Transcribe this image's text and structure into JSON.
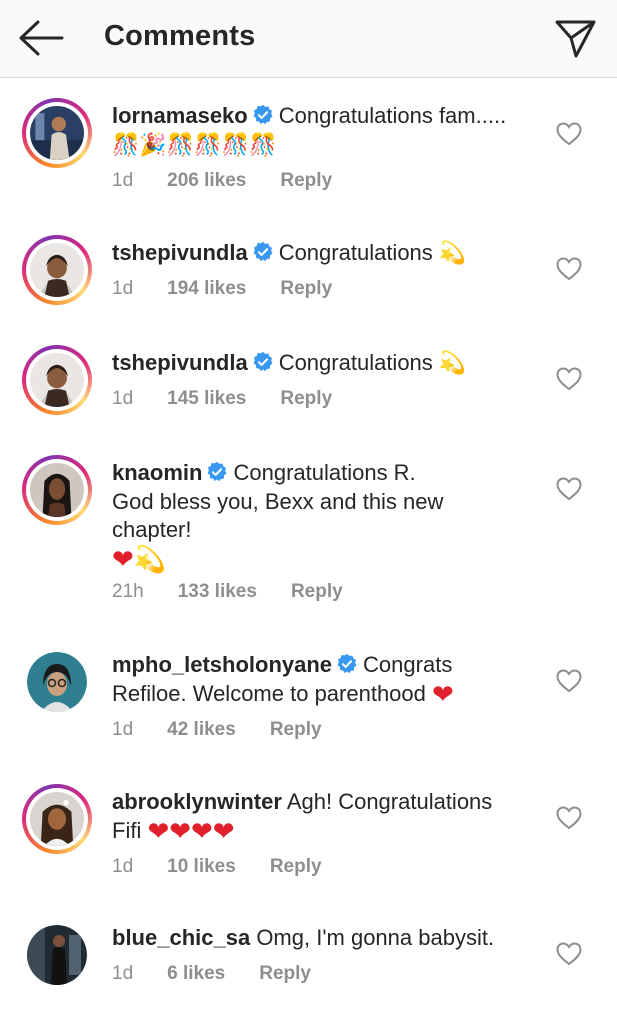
{
  "header": {
    "title": "Comments",
    "back_icon": "arrow-left-icon",
    "send_icon": "paper-plane-icon"
  },
  "comments": [
    {
      "username": "lornamaseko",
      "verified": true,
      "text": "Congratulations fam..... 🎊🎉🎊🎊🎊🎊",
      "time": "1d",
      "likes": "206 likes",
      "reply": "Reply"
    },
    {
      "username": "tshepivundla",
      "verified": true,
      "text": "Congratulations 💫",
      "time": "1d",
      "likes": "194 likes",
      "reply": "Reply"
    },
    {
      "username": "tshepivundla",
      "verified": true,
      "text": "Congratulations 💫",
      "time": "1d",
      "likes": "145 likes",
      "reply": "Reply"
    },
    {
      "username": "knaomin",
      "verified": true,
      "text_line1": "Congratulations R.",
      "text_line2": "God bless you, Bexx and this new",
      "text_line3": "chapter!",
      "emojis": "❤💫",
      "time": "21h",
      "likes": "133 likes",
      "reply": "Reply"
    },
    {
      "username": "mpho_letsholonyane",
      "verified": true,
      "text_line1": "Congrats",
      "text_line2": "Refiloe. Welcome to parenthood",
      "emoji": "❤",
      "time": "1d",
      "likes": "42 likes",
      "reply": "Reply"
    },
    {
      "username": "abrooklynwinter",
      "verified": false,
      "text_line1": "Agh! Congratulations",
      "text_line2": "Fifi",
      "emojis": "❤❤❤❤",
      "time": "1d",
      "likes": "10 likes",
      "reply": "Reply"
    },
    {
      "username": "blue_chic_sa",
      "verified": false,
      "text": "Omg, I'm gonna babysit.",
      "time": "1d",
      "likes": "6 likes",
      "reply": "Reply"
    }
  ],
  "colors": {
    "verified": "#3897f0",
    "heart": "#e0202a",
    "meta": "#8e8e8e",
    "text": "#262626"
  },
  "icons": {
    "like": "heart-outline-icon",
    "verified": "verified-badge-icon"
  }
}
